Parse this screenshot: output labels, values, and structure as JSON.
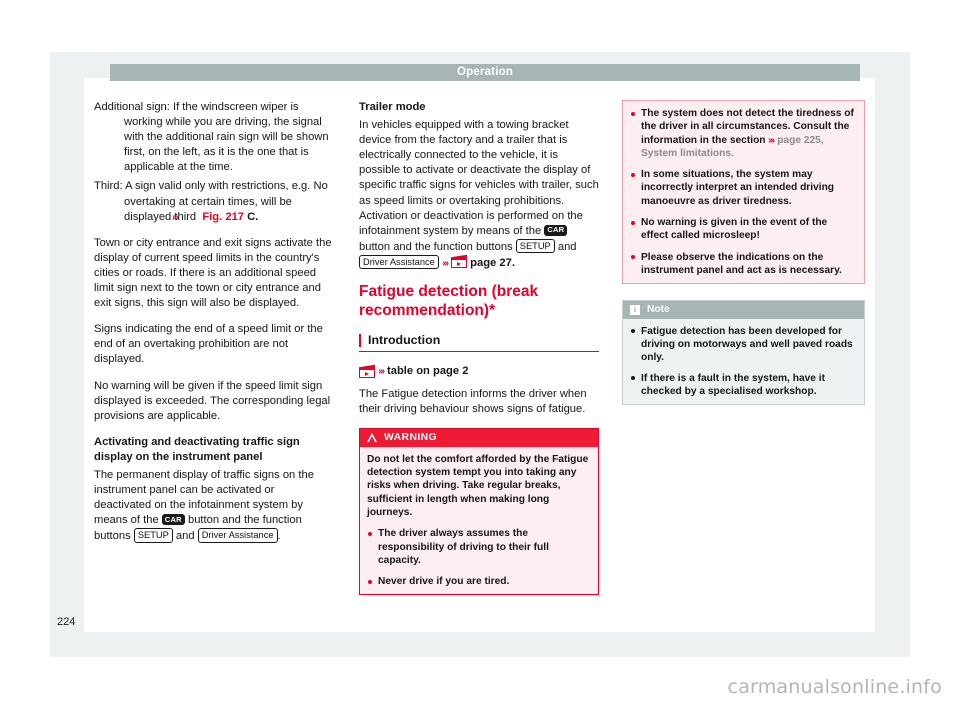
{
  "page": {
    "header_title": "Operation",
    "folio": "224",
    "watermark": "carmanualsonline.info",
    "accent_red": "#e4002b",
    "header_gray": "#a7b5b5"
  },
  "column_left": {
    "para_additional_sign": "Additional sign: If the windscreen wiper is working while you are driving, the signal with the additional rain sign will be shown first, on the left, as it is the one that is applicable at the time.",
    "para_third_prefix": "Third: A sign valid only with restrictions, e.g. No overtaking at certain times, will be displayed third ",
    "fig_ref": "Fig. 217",
    "fig_ref_suffix": "C.",
    "para_town": "Town or city entrance and exit signs activate the display of current speed limits in the country's cities or roads. If there is an additional speed limit sign next to the town or city entrance and exit signs, this sign will also be displayed.",
    "para_signs_end": "Signs indicating the end of a speed limit or the end of an overtaking prohibition are not displayed.",
    "para_no_warning": "No warning will be given if the speed limit sign displayed is exceeded. The corresponding legal provisions are applicable.",
    "heading_activating": "Activating and deactivating traffic sign display on the instrument panel",
    "para_permanent_1": "The permanent display of traffic signs on the instrument panel can be activated or deactivated on the infotainment system by means of the ",
    "key_car": "CAR",
    "para_permanent_2": " button and the function buttons ",
    "key_setup": "SETUP",
    "para_permanent_3": " and ",
    "key_driver_assistance": "Driver Assistance",
    "para_permanent_4": "."
  },
  "column_middle": {
    "heading_trailer": "Trailer mode",
    "para_trailer_1": "In vehicles equipped with a towing bracket device from the factory and a trailer that is electrically connected to the vehicle, it is possible to activate or deactivate the display of specific traffic signs for vehicles with trailer, such as speed limits or overtaking prohibitions. Activation or deactivation is performed on the infotainment system by means of the ",
    "key_car": "CAR",
    "para_trailer_2": " button and the function buttons ",
    "key_setup": "SETUP",
    "para_trailer_3": " and ",
    "key_driver_assistance": "Driver Assistance",
    "xref_page": "page 27",
    "xref_period": ".",
    "chapter_title": "Fatigue detection (break recommendation)*",
    "section_head": "Introduction",
    "table_xref": "table on page 2",
    "para_fatigue_intro": "The Fatigue detection informs the driver when their driving behaviour shows signs of fatigue.",
    "warning": {
      "label": "WARNING",
      "icon": "warning-triangle-icon",
      "paragraphs": [
        "Do not let the comfort afforded by the Fatigue detection system tempt you into taking any risks when driving. Take regular breaks, sufficient in length when making long journeys."
      ],
      "bullets": [
        "The driver always assumes the responsibility of driving to their full capacity.",
        "Never drive if you are tired."
      ]
    }
  },
  "column_right": {
    "warning_bullets": {
      "b1_part1": "The system does not detect the tiredness of the driver in all circumstances. Consult the information in the section ",
      "b1_xref": "page 225, System limitations.",
      "b2": "In some situations, the system may incorrectly interpret an intended driving manoeuvre as driver tiredness.",
      "b3": "No warning is given in the event of the effect called microsleep!",
      "b4": "Please observe the indications on the instrument panel and act as is necessary."
    },
    "note": {
      "label": "Note",
      "icon": "info-icon",
      "bullets": [
        "Fatigue detection has been developed for driving on motorways and well paved roads only.",
        "If there is a fault in the system, have it checked by a specialised workshop."
      ]
    }
  }
}
